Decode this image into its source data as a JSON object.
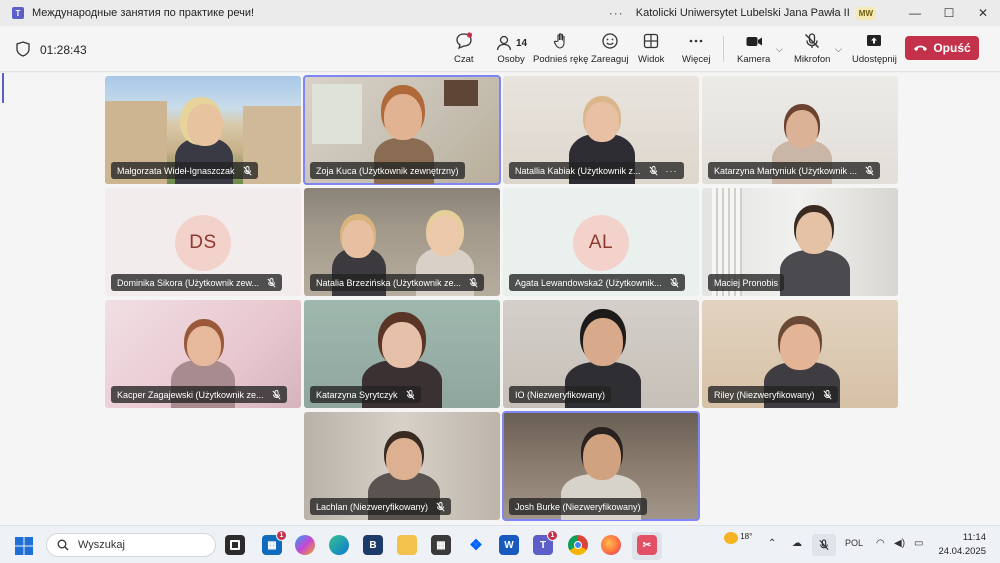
{
  "window": {
    "title": "Международные занятия по практике речи!",
    "more_label": "···",
    "org_name": "Katolicki Uniwersytet Lubelski Jana Pawła II",
    "org_badge": "MW",
    "minimize": "—",
    "maximize": "☐",
    "close": "✕"
  },
  "toolbar": {
    "timer": "01:28:43",
    "chat_label": "Czat",
    "people_label": "Osoby",
    "people_count": "14",
    "raise_hand_label": "Podnieś rękę",
    "react_label": "Zareaguj",
    "view_label": "Widok",
    "more_label": "Więcej",
    "camera_label": "Kamera",
    "mic_label": "Mikrofon",
    "share_label": "Udostępnij",
    "leave_label": "Opuść"
  },
  "participants": [
    {
      "name": "Małgorzata Wideł-Ignaszczak",
      "initials": ""
    },
    {
      "name": "Zoja Kuca (Użytkownik zewnętrzny)",
      "initials": ""
    },
    {
      "name": "Natallia Kabiak (Użytkownik z...",
      "initials": ""
    },
    {
      "name": "Katarzyna Martyniuk (Użytkownik ...",
      "initials": ""
    },
    {
      "name": "Dominika Sikora (Użytkownik zew...",
      "initials": "DS"
    },
    {
      "name": "Natalia Brzezińska (Użytkownik ze...",
      "initials": ""
    },
    {
      "name": "Agata Lewandowska2 (Użytkownik...",
      "initials": "AL"
    },
    {
      "name": "Maciej Pronobis",
      "initials": ""
    },
    {
      "name": "Kacper Zagajewski (Użytkownik ze...",
      "initials": ""
    },
    {
      "name": "Katarzyna Syrytczyk",
      "initials": ""
    },
    {
      "name": "IO (Niezweryfikowany)",
      "initials": ""
    },
    {
      "name": "Riley (Niezweryfikowany)",
      "initials": ""
    },
    {
      "name": "Lachlan (Niezweryfikowany)",
      "initials": ""
    },
    {
      "name": "Josh Burke (Niezweryfikowany)",
      "initials": ""
    }
  ],
  "taskbar": {
    "search_placeholder": "Wyszukaj",
    "store_badge": "1",
    "teams_badge": "1",
    "weather_temp": "18°",
    "language": "POL",
    "time": "11:14",
    "date": "24.04.2025"
  },
  "colors": {
    "accent": "#5b5fc7",
    "leave": "#c4314b",
    "speaking_border": "#7f85f5",
    "avatar_bg": "#f4d2cc"
  }
}
